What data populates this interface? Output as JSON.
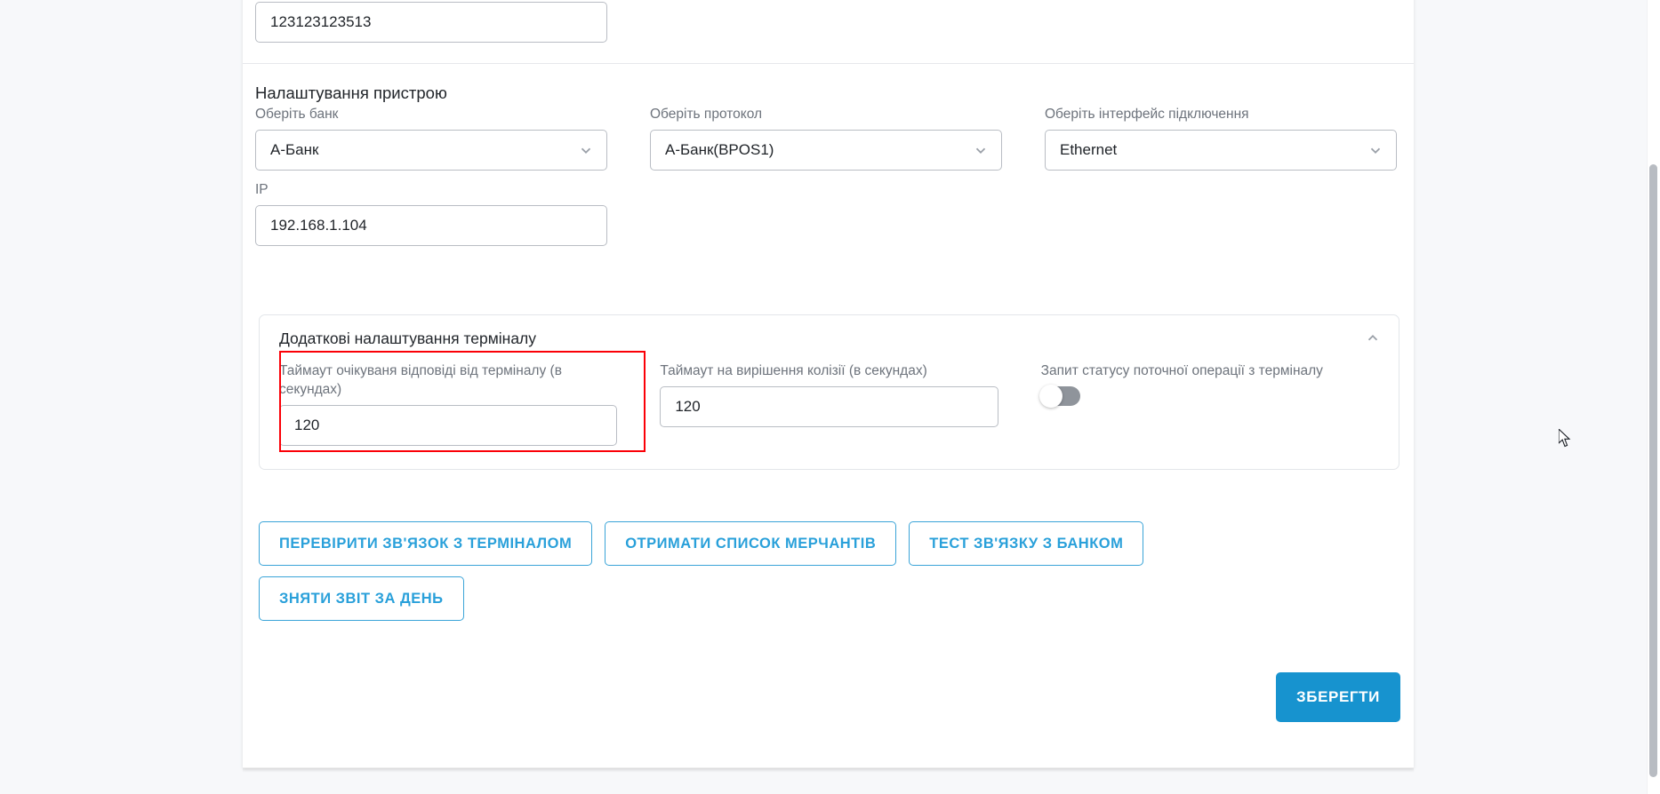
{
  "theme": {
    "accent": "#1793cf",
    "accent_outline": "#29a0da",
    "highlight": "#fb0007",
    "label_color": "#6d737c",
    "page_bg": "#f7f8fa",
    "card_bg": "#ffffff"
  },
  "top_field": {
    "value": "123123123513"
  },
  "device_settings": {
    "title": "Налаштування пристрою",
    "fields": [
      {
        "label": "Оберіть банк",
        "value": "А-Банк",
        "type": "select",
        "icon": "chevron-down-icon"
      },
      {
        "label": "Оберіть протокол",
        "value": "А-Банк(BPOS1)",
        "type": "select",
        "icon": "chevron-down-icon"
      },
      {
        "label": "Оберіть інтерфейс підключення",
        "value": "Ethernet",
        "type": "select",
        "icon": "chevron-down-icon"
      }
    ],
    "ip_field": {
      "label": "IP",
      "value": "192.168.1.104",
      "type": "text"
    }
  },
  "accordion": {
    "title": "Додаткові налаштування терміналу",
    "expanded": true,
    "collapse_icon": "chevron-up-icon",
    "fields": [
      {
        "label": "Таймаут очікуваня відповіді від терміналу (в секундах)",
        "value": "120",
        "type": "text",
        "highlighted": true
      },
      {
        "label": "Таймаут на вирішення колізії (в секундах)",
        "value": "120",
        "type": "text",
        "highlighted": false
      },
      {
        "label": "Запит статусу поточної операції з терміналу",
        "type": "toggle",
        "value": "off",
        "highlighted": false
      }
    ]
  },
  "action_buttons": {
    "row1": [
      "ПЕРЕВІРИТИ ЗВ'ЯЗОК З ТЕРМІНАЛОМ",
      "ОТРИМАТИ СПИСОК МЕРЧАНТІВ",
      "ТЕСТ ЗВ'ЯЗКУ З БАНКОМ"
    ],
    "row2": [
      "ЗНЯТИ ЗВІТ ЗА ДЕНЬ"
    ]
  },
  "save_button": {
    "label": "ЗБЕРЕГТИ"
  },
  "scrollbar": {
    "orientation": "vertical"
  }
}
